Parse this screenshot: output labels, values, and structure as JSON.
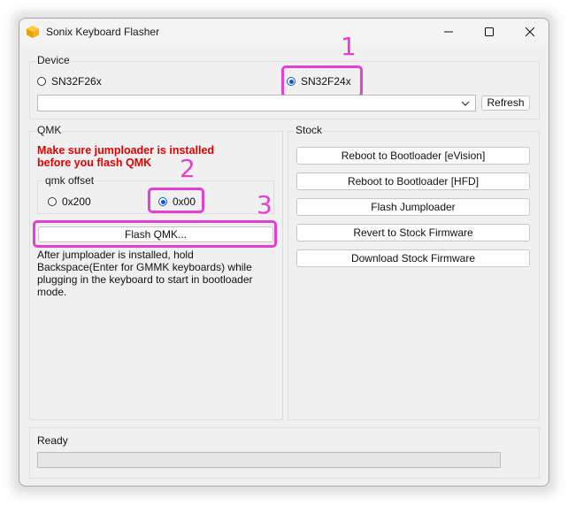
{
  "window": {
    "title": "Sonix Keyboard Flasher"
  },
  "device": {
    "group_label": "Device",
    "options": [
      "SN32F26x",
      "SN32F24x"
    ],
    "selected": "SN32F24x",
    "dropdown_value": "",
    "refresh_label": "Refresh"
  },
  "qmk": {
    "group_label": "QMK",
    "warning": "Make sure jumploader is installed before you flash QMK",
    "offset_group_label": "qmk offset",
    "offset_options": [
      "0x200",
      "0x00"
    ],
    "offset_selected": "0x00",
    "flash_label": "Flash QMK...",
    "instructions": "After jumploader is installed, hold Backspace(Enter for GMMK keyboards) while plugging in the keyboard to start in bootloader mode."
  },
  "stock": {
    "group_label": "Stock",
    "buttons": [
      "Reboot to Bootloader [eVision]",
      "Reboot to Bootloader [HFD]",
      "Flash Jumploader",
      "Revert to Stock Firmware",
      "Download Stock Firmware"
    ]
  },
  "status": {
    "text": "Ready",
    "progress": 0
  },
  "annotations": [
    "1",
    "2",
    "3"
  ],
  "colors": {
    "highlight": "#e43fd2",
    "warning": "#e20000",
    "radio_accent": "#0a58d0"
  }
}
